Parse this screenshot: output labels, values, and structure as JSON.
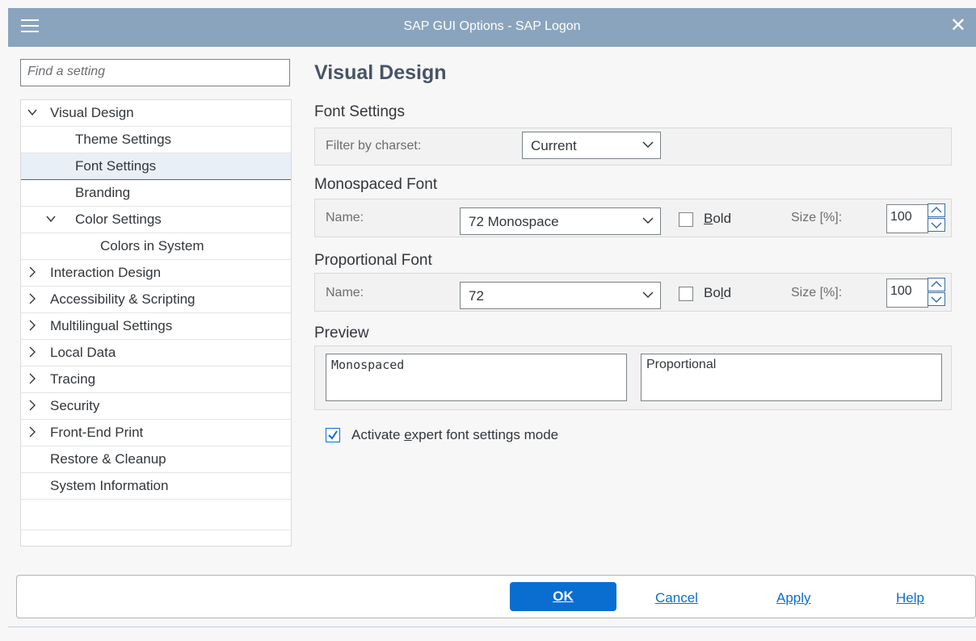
{
  "window": {
    "title": "SAP GUI Options - SAP Logon",
    "menu_icon": "hamburger-icon",
    "close_icon": "close-icon"
  },
  "search": {
    "placeholder": "Find a setting"
  },
  "tree": {
    "items": [
      {
        "label": "Visual Design",
        "expander": "expanded",
        "level": 0
      },
      {
        "label": "Theme Settings",
        "expander": "none",
        "level": 1
      },
      {
        "label": "Font Settings",
        "expander": "none",
        "level": 1,
        "selected": true
      },
      {
        "label": "Branding",
        "expander": "none",
        "level": 1
      },
      {
        "label": "Color Settings",
        "expander": "expanded",
        "level": 1
      },
      {
        "label": "Colors in System",
        "expander": "none",
        "level": 2
      },
      {
        "label": "Interaction Design",
        "expander": "collapsed",
        "level": 0
      },
      {
        "label": "Accessibility & Scripting",
        "expander": "collapsed",
        "level": 0
      },
      {
        "label": "Multilingual Settings",
        "expander": "collapsed",
        "level": 0
      },
      {
        "label": "Local Data",
        "expander": "collapsed",
        "level": 0
      },
      {
        "label": "Tracing",
        "expander": "collapsed",
        "level": 0
      },
      {
        "label": "Security",
        "expander": "collapsed",
        "level": 0
      },
      {
        "label": "Front-End Print",
        "expander": "collapsed",
        "level": 0
      },
      {
        "label": "Restore & Cleanup",
        "expander": "none",
        "level": 0
      },
      {
        "label": "System Information",
        "expander": "none",
        "level": 0
      }
    ]
  },
  "main": {
    "title": "Visual Design",
    "font_settings": {
      "heading": "Font Settings",
      "filter_label": "Filter by charset:",
      "filter_value": "Current"
    },
    "monospaced": {
      "heading": "Monospaced Font",
      "name_label": "Name:",
      "name_value": "72 Monospace",
      "bold_label_mnemonic": "B",
      "bold_label_rest": "old",
      "bold_checked": false,
      "size_label": "Size [%]:",
      "size_value": "100"
    },
    "proportional": {
      "heading": "Proportional Font",
      "name_label": "Name:",
      "name_value": "72",
      "bold_label_pre": "Bo",
      "bold_label_mnemonic": "l",
      "bold_label_rest": "d",
      "bold_checked": false,
      "size_label": "Size [%]:",
      "size_value": "100"
    },
    "preview": {
      "heading": "Preview",
      "mono_text": "Monospaced",
      "prop_text": "Proportional"
    },
    "expert_mode": {
      "label_pre": "Activate ",
      "label_mnemonic": "e",
      "label_rest": "xpert font settings mode",
      "checked": true
    }
  },
  "footer": {
    "ok": "OK",
    "cancel_mnemonic": "C",
    "cancel_rest": "ancel",
    "apply_mnemonic": "A",
    "apply_rest": "pply",
    "help_mnemonic": "H",
    "help_rest": "elp"
  },
  "colors": {
    "titlebar": "#8ba4be",
    "accent": "#0a6ed1",
    "heading": "#475466"
  }
}
